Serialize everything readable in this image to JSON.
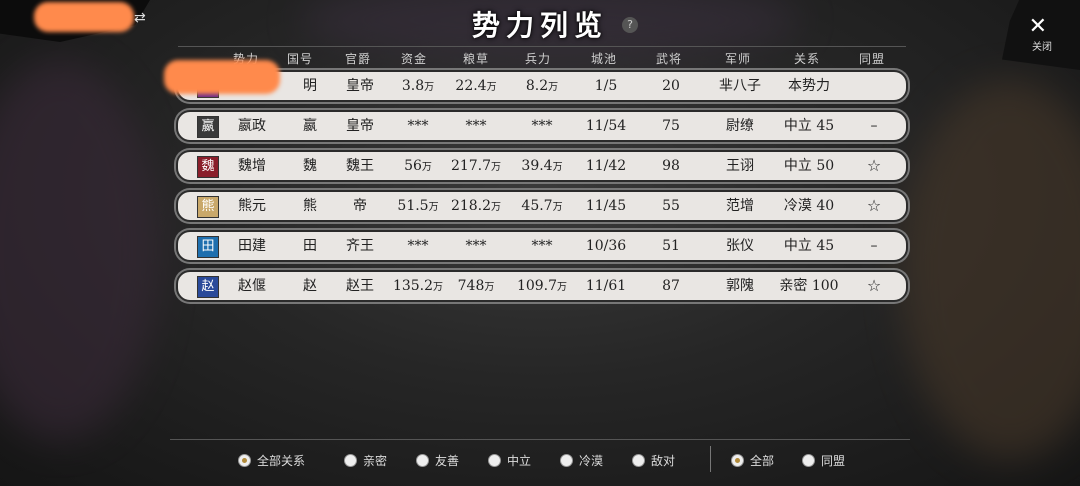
{
  "title": "势力列览",
  "help_icon": "?",
  "close": {
    "icon": "✕",
    "label": "关闭"
  },
  "swap_icon": "⇄",
  "columns": [
    "势力",
    "国号",
    "官爵",
    "资金",
    "粮草",
    "兵力",
    "城池",
    "武将",
    "军师",
    "关系",
    "同盟"
  ],
  "rows": [
    {
      "flag": "",
      "flag_color": "#6a2a8a",
      "leader": "",
      "country": "明",
      "rank": "皇帝",
      "funds": "3.8",
      "food": "22.4",
      "troops": "8.2",
      "cities": "1/5",
      "generals": "20",
      "advisor": "芈八子",
      "relation": "本势力",
      "alliance": ""
    },
    {
      "flag": "嬴",
      "flag_color": "#3a3a3a",
      "leader": "嬴政",
      "country": "嬴",
      "rank": "皇帝",
      "funds": "***",
      "food": "***",
      "troops": "***",
      "cities": "11/54",
      "generals": "75",
      "advisor": "尉缭",
      "relation": "中立 45",
      "alliance": "–"
    },
    {
      "flag": "魏",
      "flag_color": "#8a1e2a",
      "leader": "魏增",
      "country": "魏",
      "rank": "魏王",
      "funds": "56",
      "food": "217.7",
      "troops": "39.4",
      "cities": "11/42",
      "generals": "98",
      "advisor": "王诩",
      "relation": "中立 50",
      "alliance": "☆"
    },
    {
      "flag": "熊",
      "flag_color": "#c9a86a",
      "leader": "熊元",
      "country": "熊",
      "rank": "帝",
      "funds": "51.5",
      "food": "218.2",
      "troops": "45.7",
      "cities": "11/45",
      "generals": "55",
      "advisor": "范增",
      "relation": "冷漠 40",
      "alliance": "☆"
    },
    {
      "flag": "田",
      "flag_color": "#1f6fae",
      "leader": "田建",
      "country": "田",
      "rank": "齐王",
      "funds": "***",
      "food": "***",
      "troops": "***",
      "cities": "10/36",
      "generals": "51",
      "advisor": "张仪",
      "relation": "中立 45",
      "alliance": "–"
    },
    {
      "flag": "赵",
      "flag_color": "#2a4a9a",
      "leader": "赵偃",
      "country": "赵",
      "rank": "赵王",
      "funds": "135.2",
      "food": "748",
      "troops": "109.7",
      "cities": "11/61",
      "generals": "87",
      "advisor": "郭隗",
      "relation": "亲密 100",
      "alliance": "☆"
    }
  ],
  "unit": "万",
  "relation_filters": [
    {
      "label": "全部关系",
      "checked": true
    },
    {
      "label": "亲密",
      "checked": false
    },
    {
      "label": "友善",
      "checked": false
    },
    {
      "label": "中立",
      "checked": false
    },
    {
      "label": "冷漠",
      "checked": false
    },
    {
      "label": "敌对",
      "checked": false
    }
  ],
  "alliance_filters": [
    {
      "label": "全部",
      "checked": true
    },
    {
      "label": "同盟",
      "checked": false
    }
  ]
}
